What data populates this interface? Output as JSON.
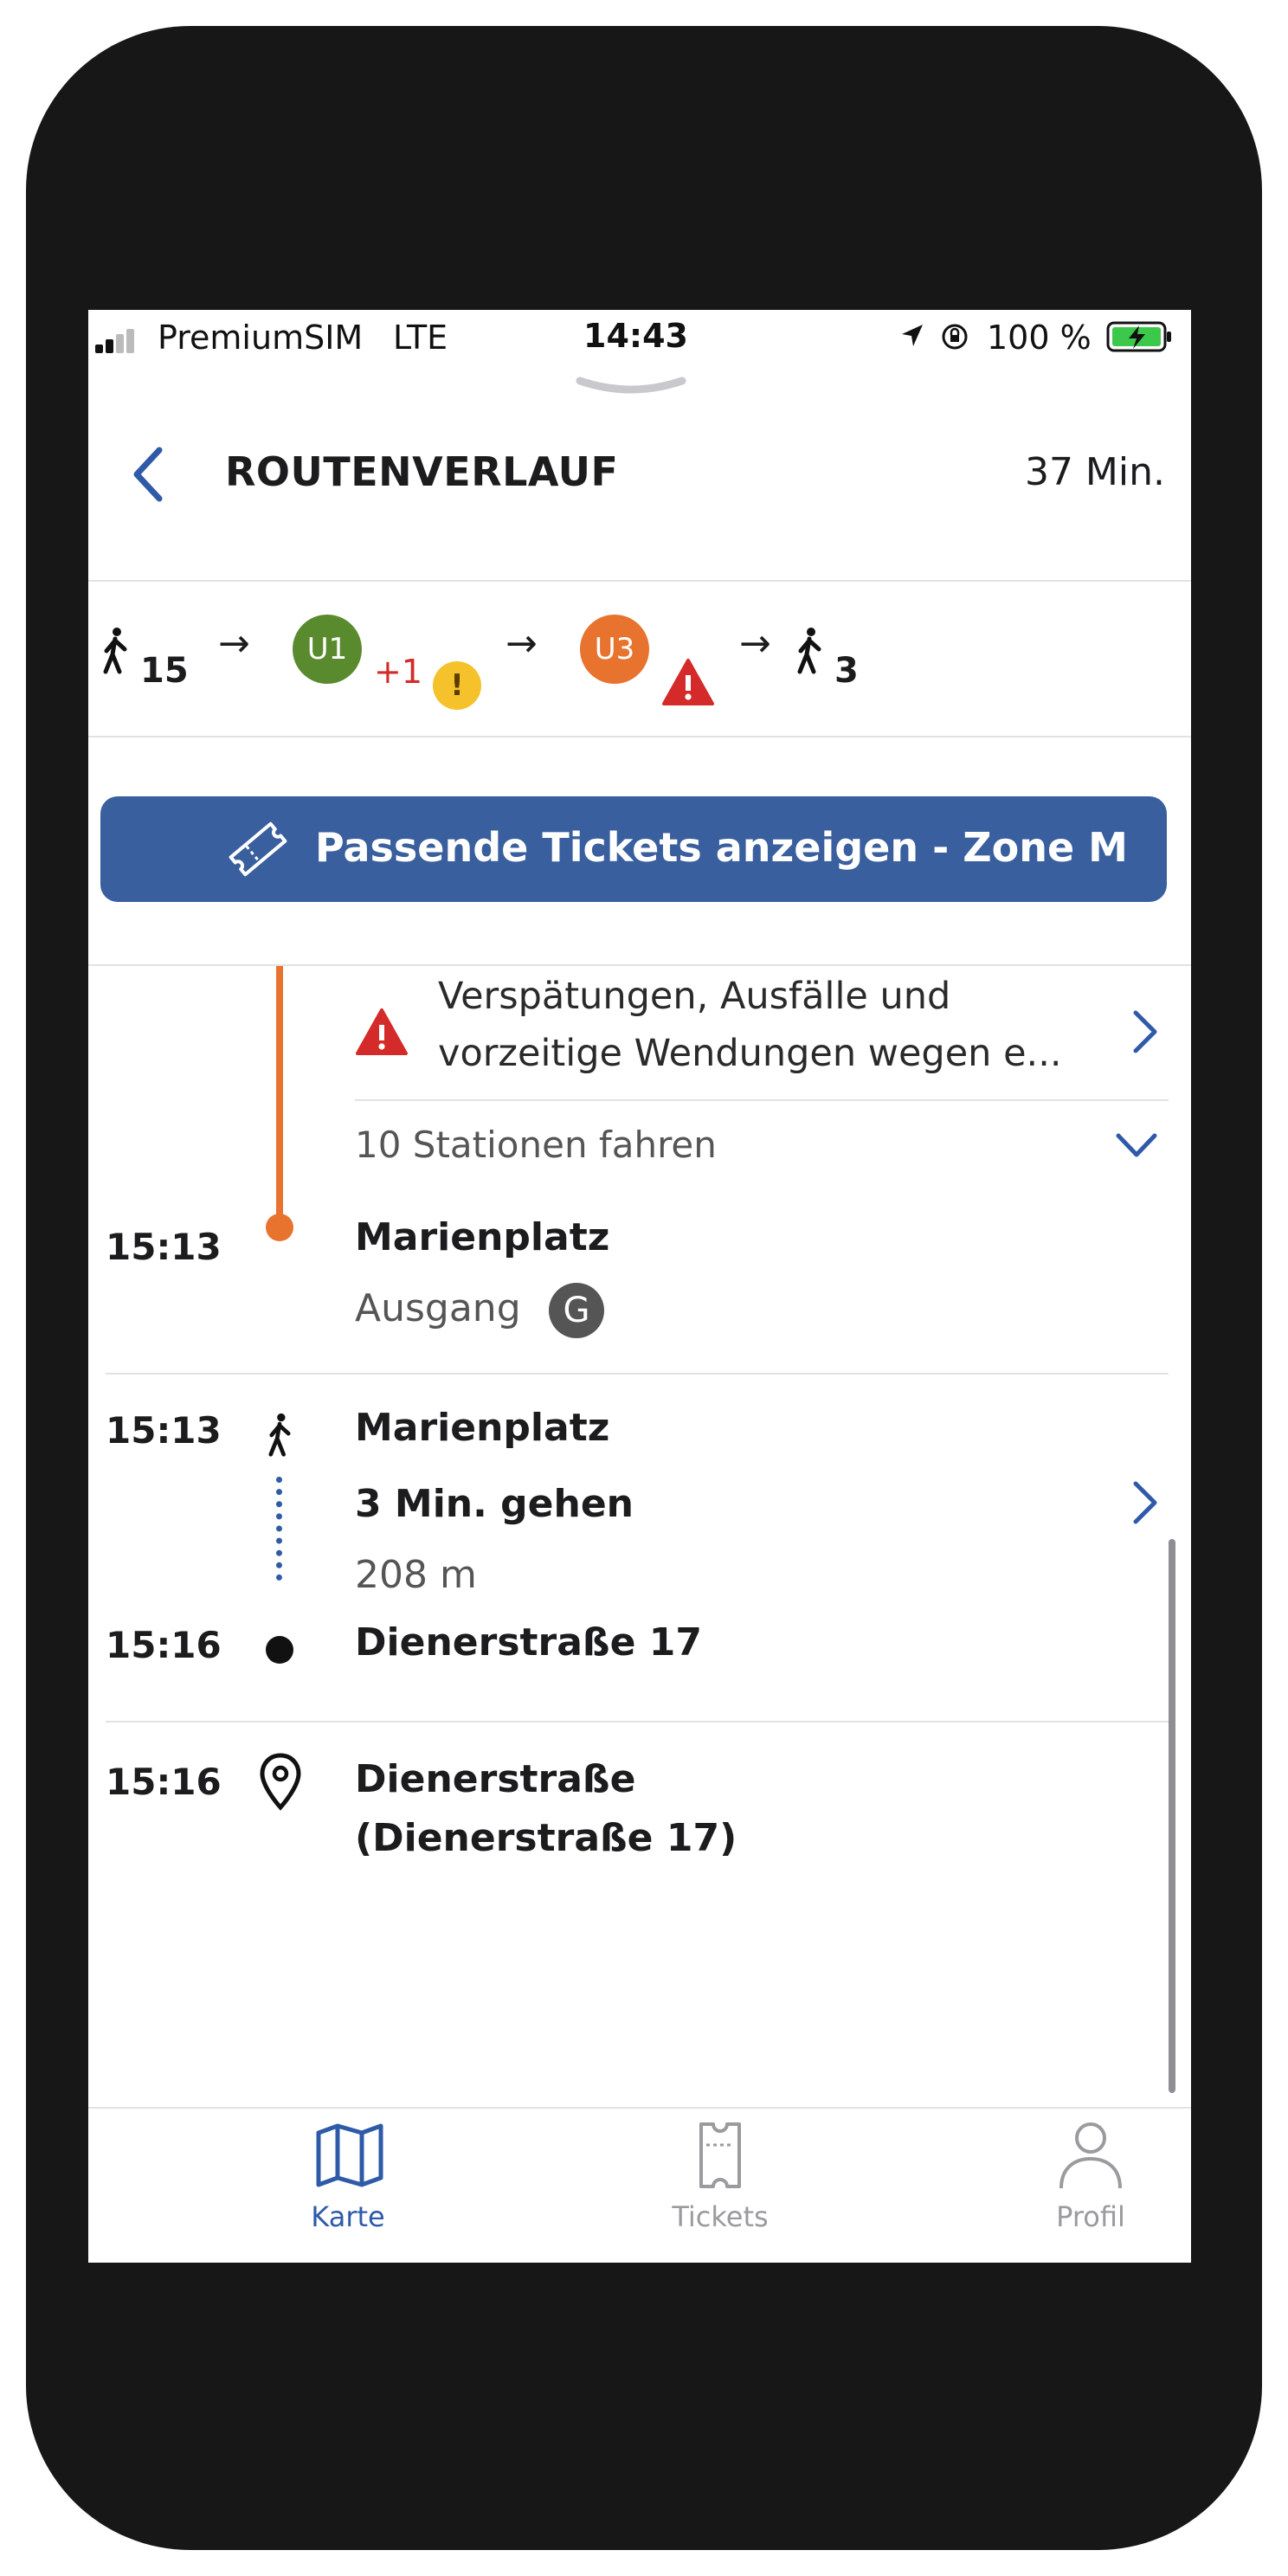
{
  "status_bar": {
    "carrier": "PremiumSIM",
    "network": "LTE",
    "time": "14:43",
    "battery": "100 %"
  },
  "header": {
    "title": "ROUTENVERLAUF",
    "duration": "37 Min."
  },
  "summary": {
    "walk_start_minutes": "15",
    "line1": {
      "name": "U1",
      "color": "#5a8a2e"
    },
    "delay": "+1",
    "line2": {
      "name": "U3",
      "color": "#e8732f"
    },
    "walk_end_minutes": "3"
  },
  "ticket_button": {
    "label": "Passende Tickets anzeigen - Zone M"
  },
  "alert": {
    "line1": "Verspätungen, Ausfälle und",
    "line2": "vorzeitige Wendungen wegen e..."
  },
  "stations_row": {
    "label": "10 Stationen fahren"
  },
  "arrival": {
    "time": "15:13",
    "stop": "Marienplatz",
    "exit_label": "Ausgang",
    "exit_code": "G"
  },
  "walk": {
    "start_time": "15:13",
    "start_stop": "Marienplatz",
    "duration": "3 Min. gehen",
    "distance": "208 m",
    "end_time": "15:16",
    "end_stop": "Dienerstraße 17"
  },
  "destination": {
    "time": "15:16",
    "name": "Dienerstraße",
    "address": "(Dienerstraße 17)"
  },
  "tab_bar": {
    "tabs": [
      {
        "label": "Karte",
        "icon": "map-icon",
        "active": true
      },
      {
        "label": "Tickets",
        "icon": "ticket-icon",
        "active": false
      },
      {
        "label": "Profil",
        "icon": "profile-icon",
        "active": false
      }
    ]
  },
  "colors": {
    "accent": "#2f5aa8",
    "u3_line": "#e8732f",
    "alert_red": "#d42a2a",
    "warning_yellow": "#f5c22c"
  }
}
